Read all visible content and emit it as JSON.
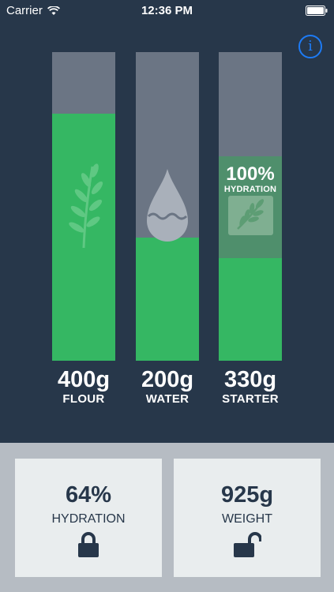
{
  "status_bar": {
    "carrier": "Carrier",
    "time": "12:36 PM"
  },
  "info_button": {
    "symbol": "i"
  },
  "columns": [
    {
      "id": "flour",
      "amount": "400g",
      "label": "FLOUR",
      "fill_fraction": 0.8,
      "icon": "wheat-icon"
    },
    {
      "id": "water",
      "amount": "200g",
      "label": "WATER",
      "fill_fraction": 0.4,
      "icon": "water-drop-icon"
    },
    {
      "id": "starter",
      "amount": "330g",
      "label": "STARTER",
      "fill_fraction": 0.33,
      "starter_overlay_fraction": 0.33,
      "icon": "wheat-icon",
      "badge": {
        "percent": "100%",
        "label": "HYDRATION"
      }
    }
  ],
  "cards": [
    {
      "id": "hydration",
      "value": "64%",
      "caption": "HYDRATION",
      "icon": "locked-lock-icon"
    },
    {
      "id": "weight",
      "value": "925g",
      "caption": "WEIGHT",
      "icon": "unlocked-lock-icon"
    }
  ],
  "colors": {
    "background": "#27374a",
    "column_empty": "#6b7584",
    "column_fill": "#35b763",
    "accent": "#1d7bf5",
    "card_bg": "#e9edee",
    "panel_bg": "#b6bcc3"
  }
}
